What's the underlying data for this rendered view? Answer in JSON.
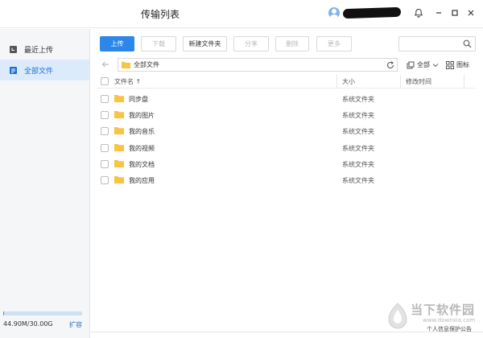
{
  "window": {
    "title": "传输列表"
  },
  "sidebar": {
    "items": [
      {
        "label": "最近上传",
        "icon": "clock-doc-icon"
      },
      {
        "label": "全部文件",
        "icon": "file-list-icon"
      }
    ],
    "quota": {
      "text": "44.90M/30.00G",
      "used_fraction": 0.0015,
      "expand_label": "扩容"
    }
  },
  "toolbar": {
    "upload": "上传",
    "download": "下载",
    "new_folder": "新建文件夹",
    "share": "分享",
    "delete": "删除",
    "more": "更多",
    "search_placeholder": ""
  },
  "pathbar": {
    "path": "全部文件",
    "filter_label": "全部",
    "view_label": "图标"
  },
  "table": {
    "columns": {
      "name": "文件名 ↑",
      "size": "大小",
      "modified": "修改时间"
    },
    "rows": [
      {
        "name": "同步盘",
        "size": "系统文件夹",
        "modified": ""
      },
      {
        "name": "我的图片",
        "size": "系统文件夹",
        "modified": ""
      },
      {
        "name": "我的音乐",
        "size": "系统文件夹",
        "modified": ""
      },
      {
        "name": "我的视频",
        "size": "系统文件夹",
        "modified": ""
      },
      {
        "name": "我的文档",
        "size": "系统文件夹",
        "modified": ""
      },
      {
        "name": "我的应用",
        "size": "系统文件夹",
        "modified": ""
      }
    ]
  },
  "watermark": {
    "brand": "当下软件园",
    "url": "www.downxia.com",
    "privacy": "个人信息保护公告"
  },
  "colors": {
    "accent": "#2c87e8",
    "folder": "#f7c443",
    "sidebar_active": "#dcebfb"
  }
}
